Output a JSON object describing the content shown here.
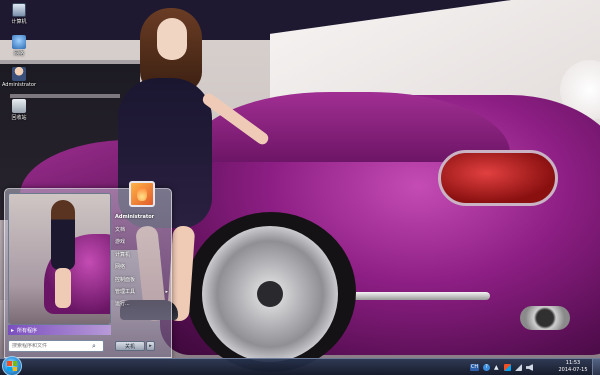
{
  "desktop": {
    "icons": [
      {
        "label": "计算机",
        "icon": "computer-icon"
      },
      {
        "label": "网络",
        "icon": "network-icon"
      },
      {
        "label": "Administrator",
        "icon": "user-folder-icon"
      },
      {
        "label": "回收站",
        "icon": "recycle-bin-icon"
      }
    ]
  },
  "start_menu": {
    "all_programs_label": "所有程序",
    "search_placeholder": "搜索程序和文件",
    "user_name": "Administrator",
    "right_items": [
      {
        "label": "文档",
        "has_submenu": false
      },
      {
        "label": "游戏",
        "has_submenu": false
      },
      {
        "label": "计算机",
        "has_submenu": false
      },
      {
        "label": "网络",
        "has_submenu": false
      },
      {
        "label": "控制面板",
        "has_submenu": false
      },
      {
        "label": "管理工具",
        "has_submenu": true
      },
      {
        "label": "运行...",
        "has_submenu": false
      }
    ],
    "submenu_glyph": "▸",
    "shutdown_label": "关机",
    "shutdown_arrow": "▸"
  },
  "taskbar": {
    "tray_language": "CH",
    "tray_help": "?",
    "tray_expand_glyph": "▲",
    "time": "11:53",
    "date": "2014-07-15"
  },
  "colors": {
    "start_orb": "#3aa0e6",
    "all_programs_bar": "#7b4fbf",
    "car_paint": "#8e1f85"
  }
}
